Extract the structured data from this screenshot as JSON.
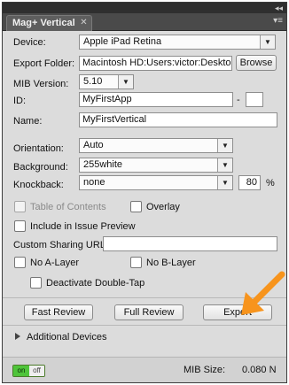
{
  "panel": {
    "tab_title": "Mag+ Vertical",
    "collapse_glyph": "◂◂",
    "tab_close_glyph": "✕",
    "menu_glyph": "▾≡"
  },
  "device": {
    "label": "Device:",
    "value": "Apple iPad Retina"
  },
  "export_folder": {
    "label": "Export Folder:",
    "value": "Macintosh HD:Users:victor:Desktop:KW C",
    "browse_label": "Browse"
  },
  "mib_version": {
    "label": "MIB Version:",
    "value": "5.10"
  },
  "id": {
    "label": "ID:",
    "value": "MyFirstApp",
    "separator": "-",
    "suffix": ""
  },
  "name": {
    "label": "Name:",
    "value": "MyFirstVertical"
  },
  "orientation": {
    "label": "Orientation:",
    "value": "Auto"
  },
  "background": {
    "label": "Background:",
    "value": "255white"
  },
  "knockback": {
    "label": "Knockback:",
    "value": "none",
    "percent_value": "80",
    "percent_sign": "%"
  },
  "options": {
    "table_of_contents": "Table of Contents",
    "overlay": "Overlay",
    "include_in_issue_preview": "Include in Issue Preview",
    "custom_sharing_url_label": "Custom Sharing URL:",
    "custom_sharing_url_value": "",
    "no_a_layer": "No A-Layer",
    "no_b_layer": "No B-Layer",
    "deactivate_double_tap": "Deactivate Double-Tap"
  },
  "actions": {
    "fast_review": "Fast Review",
    "full_review": "Full Review",
    "export": "Export"
  },
  "additional_devices": "Additional Devices",
  "footer": {
    "toggle_on": "on",
    "toggle_off": "off",
    "mib_size_label": "MIB Size:",
    "mib_size_value": "0.080 N"
  },
  "colors": {
    "accent_arrow": "#f7941d",
    "toggle_on": "#4fc43a"
  }
}
